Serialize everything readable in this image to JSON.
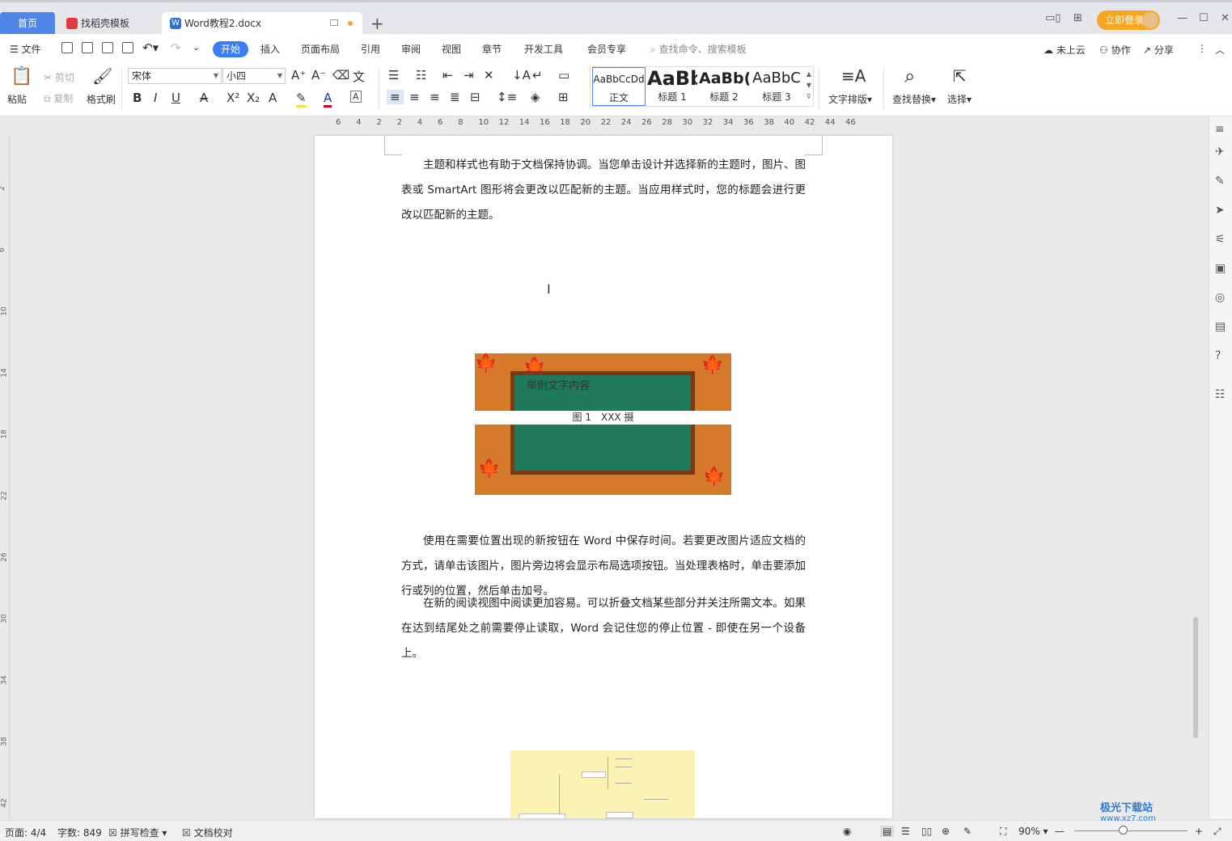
{
  "tabs": {
    "home": "首页",
    "template": "找稻壳模板",
    "doc": "Word教程2.docx",
    "doc_icon": "W"
  },
  "top_right": {
    "login": "立即登录"
  },
  "menu": {
    "file": "文件",
    "items": [
      "开始",
      "插入",
      "页面布局",
      "引用",
      "审阅",
      "视图",
      "章节",
      "开发工具",
      "会员专享"
    ],
    "search": "查找命令、搜索模板",
    "cloud": "未上云",
    "collab": "协作",
    "share": "分享"
  },
  "ribbon": {
    "paste": "粘贴",
    "cut": "剪切",
    "copy": "复制",
    "format_painter": "格式刷",
    "font": "宋体",
    "size": "小四",
    "styles": [
      {
        "sample": "AaBbCcDd",
        "label": "正文"
      },
      {
        "sample": "AaBb",
        "label": "标题 1"
      },
      {
        "sample": "AaBb(",
        "label": "标题 2"
      },
      {
        "sample": "AaBbC",
        "label": "标题 3"
      }
    ],
    "text_layout": "文字排版",
    "find_replace": "查找替换",
    "select": "选择"
  },
  "ruler": {
    "numbers": [
      "6",
      "4",
      "2",
      "2",
      "4",
      "6",
      "8",
      "10",
      "12",
      "14",
      "16",
      "18",
      "20",
      "22",
      "24",
      "26",
      "28",
      "30",
      "32",
      "34",
      "36",
      "38",
      "40",
      "42",
      "44",
      "46"
    ]
  },
  "document": {
    "para1": "主题和样式也有助于文档保持协调。当您单击设计并选择新的主题时，图片、图表或 SmartArt 图形将会更改以匹配新的主题。当应用样式时，您的标题会进行更改以匹配新的主题。",
    "image_text": "举例文字内容",
    "caption": "图 1　XXX 摄",
    "para2": "使用在需要位置出现的新按钮在 Word 中保存时间。若要更改图片适应文档的方式，请单击该图片，图片旁边将会显示布局选项按钮。当处理表格时，单击要添加行或列的位置，然后单击加号。",
    "para3": "在新的阅读视图中阅读更加容易。可以折叠文档某些部分并关注所需文本。如果在达到结尾处之前需要停止读取，Word 会记住您的停止位置 - 即使在另一个设备上。"
  },
  "status": {
    "page": "页面: 4/4",
    "words": "字数: 849",
    "spell": "拼写检查",
    "proof": "文档校对",
    "zoom": "90%"
  },
  "watermark": {
    "name": "极光下载站",
    "url": "www.xz7.com"
  },
  "colors": {
    "accent": "#3c7cf0",
    "home_tab": "#4f86e8",
    "login": "#f6a623",
    "board": "#1f7a5a"
  }
}
